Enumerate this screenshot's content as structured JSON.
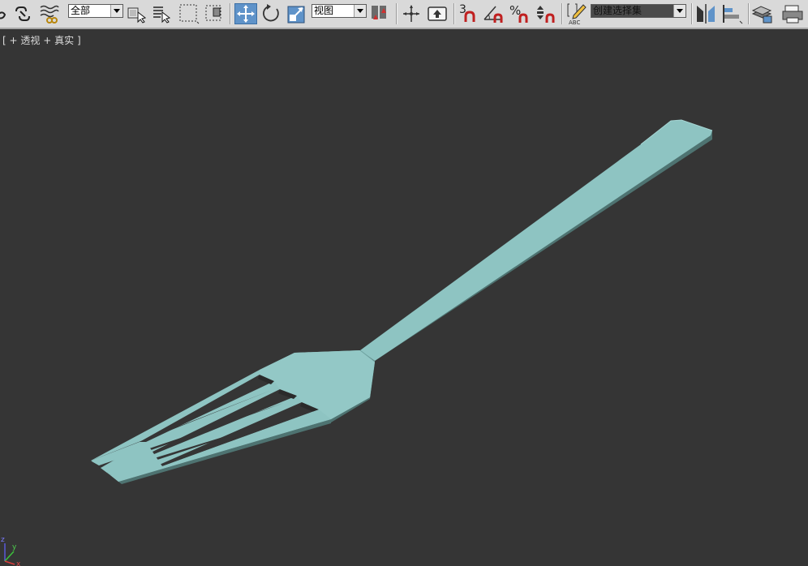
{
  "toolbar": {
    "selection_filter": "全部",
    "reference_coord": "视图",
    "snap_label": "3",
    "percent_label": "%",
    "named_selection_placeholder": "创建选择集",
    "abc_label": "ABC",
    "icons": [
      "undo-icon",
      "link-icon",
      "unlink-icon",
      "bind-space-warp-icon",
      "select-object-icon",
      "select-by-name-icon",
      "rect-selection-icon",
      "window-crossing-icon",
      "select-move-icon",
      "select-rotate-icon",
      "select-scale-icon",
      "named-selection-icon",
      "pivot-center-icon",
      "manipulate-icon",
      "keyboard-shortcut-icon",
      "snap-3d-icon",
      "angle-snap-icon",
      "percent-snap-icon",
      "spinner-snap-icon",
      "edit-named-sets-icon",
      "mirror-icon",
      "align-icon",
      "layer-manager-icon",
      "render-setup-icon"
    ]
  },
  "viewport": {
    "bracket_open": "[",
    "plus_marker": "+",
    "label_view": "透视",
    "label_shading": "真实",
    "bracket_close": "]"
  },
  "axis": {
    "x": "x",
    "y": "y",
    "z": "z"
  },
  "colors": {
    "viewport_bg": "#353535",
    "toolbar_bg": "#d9d9d9",
    "fork_top": "#8ec4c2",
    "fork_side": "#4e7371",
    "fork_edge": "#6fa3a1",
    "active_button": "#5f93c9"
  }
}
